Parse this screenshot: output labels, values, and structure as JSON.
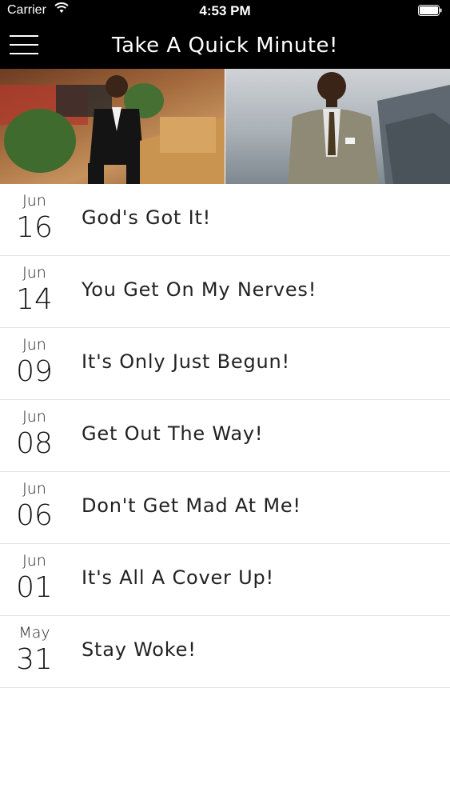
{
  "status_bar": {
    "carrier": "Carrier",
    "time": "4:53 PM"
  },
  "nav": {
    "title": "Take A Quick Minute!",
    "menu_icon": "hamburger-menu-icon"
  },
  "hero": {
    "left_image": "preacher-at-pulpit",
    "right_image": "preacher-in-suit"
  },
  "colors": {
    "nav_bg": "#000000",
    "row_divider": "#e2e2e2",
    "background": "#ffffff"
  },
  "posts": [
    {
      "month": "Jun",
      "day": "16",
      "title": "God's Got It!"
    },
    {
      "month": "Jun",
      "day": "14",
      "title": "You Get On My Nerves!"
    },
    {
      "month": "Jun",
      "day": "09",
      "title": "It's Only Just Begun!"
    },
    {
      "month": "Jun",
      "day": "08",
      "title": "Get Out The Way!"
    },
    {
      "month": "Jun",
      "day": "06",
      "title": "Don't Get Mad At Me!"
    },
    {
      "month": "Jun",
      "day": "01",
      "title": "It's All A Cover Up!"
    },
    {
      "month": "May",
      "day": "31",
      "title": "Stay Woke!"
    }
  ]
}
